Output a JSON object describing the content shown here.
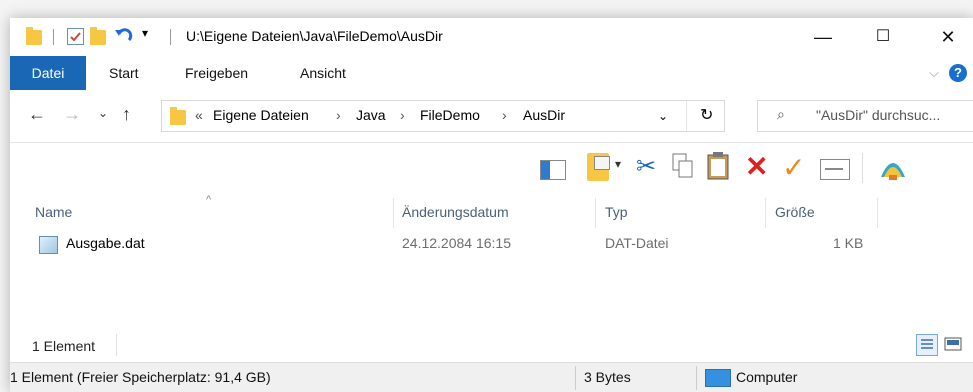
{
  "window": {
    "path_title": "U:\\Eigene Dateien\\Java\\FileDemo\\AusDir",
    "minimize": "—",
    "maximize": "☐",
    "close": "✕"
  },
  "ribbon": {
    "tabs": [
      "Datei",
      "Start",
      "Freigeben",
      "Ansicht"
    ]
  },
  "nav": {
    "breadcrumb": [
      "Eigene Dateien",
      "Java",
      "FileDemo",
      "AusDir"
    ],
    "overflow": "«",
    "search_placeholder": "\"AusDir\" durchsuc..."
  },
  "columns": [
    "Name",
    "Änderungsdatum",
    "Typ",
    "Größe"
  ],
  "files": [
    {
      "name": "Ausgabe.dat",
      "modified": "24.12.2084 16:15",
      "type": "DAT-Datei",
      "size": "1 KB"
    }
  ],
  "status": {
    "count": "1 Element",
    "footer_left": "1 Element (Freier Speicherplatz: 91,4 GB)",
    "footer_size": "3 Bytes",
    "footer_location": "Computer"
  },
  "colors": {
    "accent": "#1a68b5",
    "folder": "#f7c744",
    "delete": "#e0201c",
    "check": "#f08a1c"
  }
}
